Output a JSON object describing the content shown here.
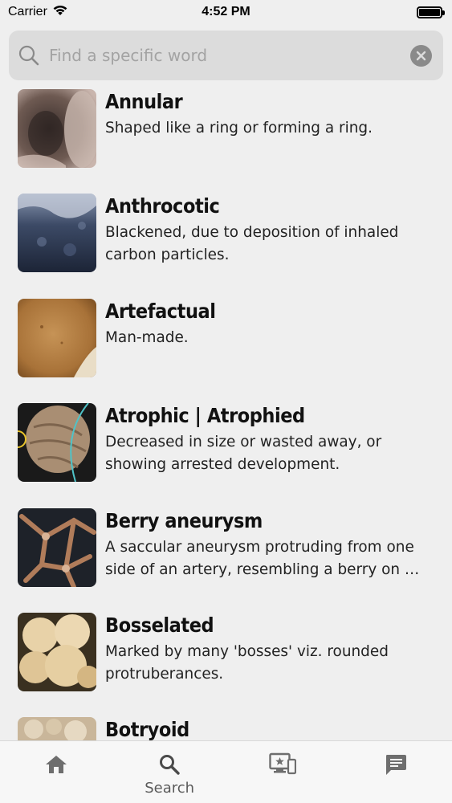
{
  "status_bar": {
    "carrier": "Carrier",
    "time": "4:52 PM",
    "battery_level": 1.0
  },
  "search": {
    "placeholder": "Find a specific word",
    "value": ""
  },
  "glossary": [
    {
      "term": "Annular",
      "definition": "Shaped like a ring or forming a ring."
    },
    {
      "term": "Anthrocotic",
      "definition": "Blackened, due to deposition of inhaled carbon particles."
    },
    {
      "term": "Artefactual",
      "definition": "Man-made."
    },
    {
      "term": "Atrophic | Atrophied",
      "definition": "Decreased in size or wasted away, or showing arrested development."
    },
    {
      "term": "Berry aneurysm",
      "definition": "A saccular aneurysm protruding from one side of an artery, resembling a berry on …"
    },
    {
      "term": "Bosselated",
      "definition": "Marked by many 'bosses' viz. rounded protruberances."
    },
    {
      "term": "Botryoid",
      "definition": ""
    }
  ],
  "tab_bar": {
    "tabs": [
      {
        "name": "home",
        "label": "",
        "icon": "home-icon"
      },
      {
        "name": "search",
        "label": "Search",
        "icon": "search-icon"
      },
      {
        "name": "presentation",
        "label": "",
        "icon": "monitor-star-icon"
      },
      {
        "name": "messages",
        "label": "",
        "icon": "chat-icon"
      }
    ],
    "active_color": "#4a4a4a",
    "inactive_color": "#6e6e6e"
  }
}
